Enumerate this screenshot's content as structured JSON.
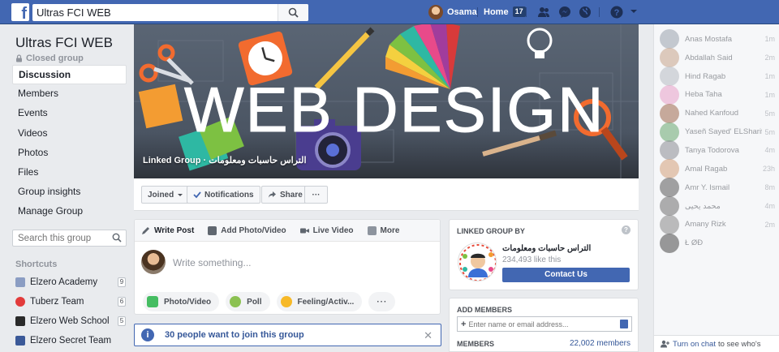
{
  "topbar": {
    "search_value": "Ultras FCI WEB",
    "user_name": "Osama",
    "home_label": "Home",
    "home_count": "17",
    "colors": {
      "bar": "#4267b2"
    }
  },
  "group": {
    "title": "Ultras FCI WEB",
    "privacy": "Closed group",
    "nav": [
      "Discussion",
      "Members",
      "Events",
      "Videos",
      "Photos",
      "Files",
      "Group insights",
      "Manage Group"
    ],
    "search_placeholder": "Search this group"
  },
  "shortcuts": {
    "title": "Shortcuts",
    "items": [
      {
        "label": "Elzero Academy",
        "count": "9",
        "color": "#8b9dc3"
      },
      {
        "label": "Tuberz Team",
        "count": "6",
        "color": "#e23b3b"
      },
      {
        "label": "Elzero Web School",
        "count": "5",
        "color": "#2a2a2a"
      },
      {
        "label": "Elzero Secret Team",
        "count": "",
        "color": "#3b5998"
      }
    ]
  },
  "cover": {
    "headline": "WEB DESIGN",
    "caption": "Linked Group · التراس حاسبات ومعلومات"
  },
  "actions": {
    "joined": "Joined",
    "notifications": "Notifications",
    "share": "Share",
    "more": "···"
  },
  "composer": {
    "tabs": [
      "Write Post",
      "Add Photo/Video",
      "Live Video",
      "More"
    ],
    "placeholder": "Write something...",
    "buttons": [
      "Photo/Video",
      "Poll",
      "Feeling/Activ...",
      "···"
    ]
  },
  "notice": {
    "text": "30 people want to join this group"
  },
  "linked_group": {
    "title": "LINKED GROUP BY",
    "name": "التراس حاسبات ومعلومات",
    "likes": "234,493 like this",
    "contact": "Contact Us"
  },
  "add_members": {
    "title": "ADD MEMBERS",
    "placeholder": "Enter name or email address...",
    "members_label": "MEMBERS",
    "members_count": "22,002 members"
  },
  "chat": {
    "contacts": [
      {
        "name": "Anas Mostafa",
        "time": "1m"
      },
      {
        "name": "Abdallah Said",
        "time": "2m"
      },
      {
        "name": "Hind Ragab",
        "time": "1m"
      },
      {
        "name": "Heba Taha",
        "time": "1m"
      },
      {
        "name": "Nahed Kanfoud",
        "time": "5m"
      },
      {
        "name": "Yaseñ Sayed' ELSharif",
        "time": "5m"
      },
      {
        "name": "Tanya Todorova",
        "time": "4m"
      },
      {
        "name": "Amal Ragab",
        "time": "23h"
      },
      {
        "name": "Amr Y. Ismail",
        "time": "8m"
      },
      {
        "name": "محمد يحيى",
        "time": "4m"
      },
      {
        "name": "Amany Rizk",
        "time": "2m"
      },
      {
        "name": "Ł ØĐ",
        "time": ""
      }
    ],
    "footer_link": "Turn on chat",
    "footer_text": "to see who's"
  }
}
